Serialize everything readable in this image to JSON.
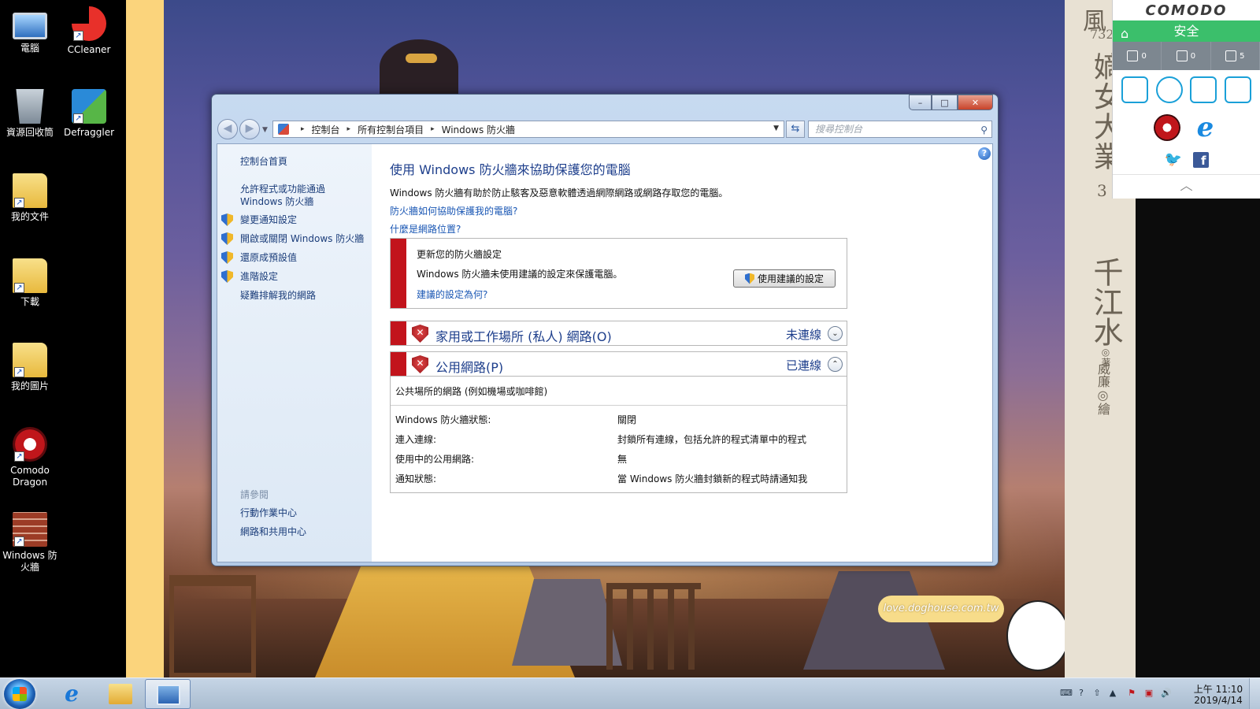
{
  "desktop": {
    "icons": [
      {
        "label": "電腦",
        "icon": "computer-icon",
        "shortcut": false
      },
      {
        "label": "CCleaner",
        "icon": "ccleaner-icon",
        "shortcut": true
      },
      {
        "label": "資源回收筒",
        "icon": "recycle-bin-icon",
        "shortcut": false
      },
      {
        "label": "Defraggler",
        "icon": "defraggler-icon",
        "shortcut": true
      },
      {
        "label": "我的文件",
        "icon": "documents-folder-icon",
        "shortcut": true
      },
      {
        "label": "下載",
        "icon": "downloads-folder-icon",
        "shortcut": true
      },
      {
        "label": "我的圖片",
        "icon": "pictures-folder-icon",
        "shortcut": true
      },
      {
        "label": "Comodo Dragon",
        "icon": "comodo-dragon-icon",
        "shortcut": true
      },
      {
        "label": "Windows 防火牆",
        "icon": "windows-firewall-icon",
        "shortcut": true
      }
    ],
    "wallpaper": {
      "book_char": "風",
      "book_number": "732",
      "book_title": "嫡女大業",
      "book_volume": "3",
      "book_author": "千江水",
      "book_author_suffix": "◎著",
      "book_illustrator": "威廉◎繪",
      "banner_text": "love.doghouse.com.tw"
    }
  },
  "window": {
    "controls": {
      "minimize": "–",
      "maximize": "□",
      "close": "✕"
    },
    "nav": {
      "back": "◀",
      "forward": "▶",
      "dropdown": "▼"
    },
    "breadcrumb": [
      "控制台",
      "所有控制台項目",
      "Windows 防火牆"
    ],
    "breadcrumb_sep": "▸",
    "address_dropdown": "▼",
    "refresh": "⇆",
    "search": {
      "placeholder": "搜尋控制台",
      "glyph": "⚲"
    },
    "sidebar": {
      "home": "控制台首頁",
      "links": [
        {
          "label": "允許程式或功能通過 Windows 防火牆",
          "shield": false
        },
        {
          "label": "變更通知設定",
          "shield": true
        },
        {
          "label": "開啟或關閉 Windows 防火牆",
          "shield": true
        },
        {
          "label": "還原成預設值",
          "shield": true
        },
        {
          "label": "進階設定",
          "shield": true
        },
        {
          "label": "疑難排解我的網路",
          "shield": false
        }
      ],
      "see_also_title": "請參閱",
      "see_also": [
        "行動作業中心",
        "網路和共用中心"
      ]
    },
    "main": {
      "help": "?",
      "title": "使用 Windows 防火牆來協助保護您的電腦",
      "description": "Windows 防火牆有助於防止駭客及惡意軟體透過網際網路或網路存取您的電腦。",
      "link_how": "防火牆如何協助保護我的電腦?",
      "link_location": "什麼是網路位置?",
      "warning": {
        "title": "更新您的防火牆設定",
        "description": "Windows 防火牆未使用建議的設定來保護電腦。",
        "link": "建議的設定為何?",
        "button": "使用建議的設定"
      },
      "networks": [
        {
          "name": "家用或工作場所 (私人) 網路(O)",
          "state": "未連線",
          "toggle": "⌄",
          "expanded": false
        },
        {
          "name": "公用網路(P)",
          "state": "已連線",
          "toggle": "⌃",
          "expanded": true
        }
      ],
      "public_description": "公共場所的網路 (例如機場或咖啡館)",
      "details": [
        {
          "label": "Windows 防火牆狀態:",
          "value": "關閉"
        },
        {
          "label": "連入連線:",
          "value": "封鎖所有連線，包括允許的程式清單中的程式"
        },
        {
          "label": "使用中的公用網路:",
          "value": "無"
        },
        {
          "label": "通知狀態:",
          "value": "當 Windows 防火牆封鎖新的程式時請通知我"
        }
      ]
    }
  },
  "comodo": {
    "logo": "COMODO",
    "status": "安全",
    "home_glyph": "⌂",
    "counters": [
      "0",
      "0",
      "5"
    ],
    "collapse": "︿",
    "twitter_glyph": "🐦",
    "facebook_glyph": "f",
    "ie_glyph": "e"
  },
  "taskbar": {
    "ie_glyph": "e",
    "clock_time": "上午 11:10",
    "clock_date": "2019/4/14",
    "tray": [
      "⌨",
      "?",
      "⇧",
      "▲",
      "⚑",
      "▣",
      "🔊"
    ]
  },
  "colors": {
    "accent": "#1e3f8c",
    "link": "#1a57b4",
    "danger": "#c2141c",
    "comodo_green": "#3bbf6b"
  }
}
